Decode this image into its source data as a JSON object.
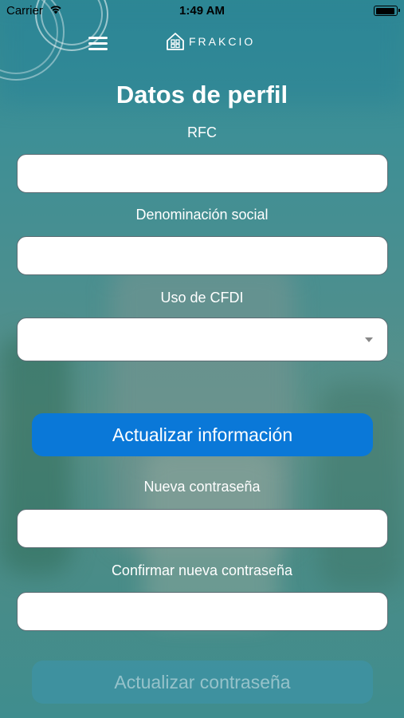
{
  "status_bar": {
    "carrier": "Carrier",
    "time": "1:49 AM"
  },
  "header": {
    "logo_text": "FRAKCIO"
  },
  "page": {
    "title": "Datos de perfil"
  },
  "profile_form": {
    "rfc_label": "RFC",
    "rfc_value": "",
    "denominacion_label": "Denominación social",
    "denominacion_value": "",
    "uso_cfdi_label": "Uso de CFDI",
    "uso_cfdi_value": "",
    "update_info_button": "Actualizar información"
  },
  "password_form": {
    "new_password_label": "Nueva contraseña",
    "new_password_value": "",
    "confirm_password_label": "Confirmar nueva contraseña",
    "confirm_password_value": "",
    "update_password_button": "Actualizar contraseña"
  },
  "colors": {
    "accent": "#0a78d8",
    "background": "#3f8d8e"
  }
}
